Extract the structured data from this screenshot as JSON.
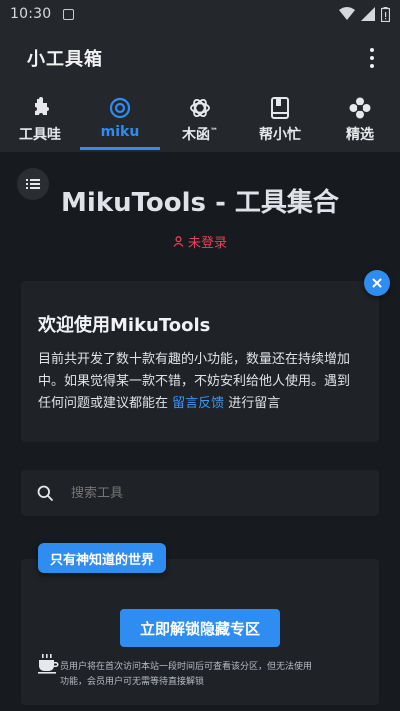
{
  "status_bar": {
    "time": "10:30",
    "icons": [
      "notification-icon",
      "wifi-icon",
      "signal-icon",
      "battery-icon"
    ]
  },
  "app_bar": {
    "title": "小工具箱",
    "menu_icon": "more-vert-icon"
  },
  "tabs": [
    {
      "label": "工具哇",
      "icon": "puzzle-icon",
      "active": false
    },
    {
      "label": "miku",
      "icon": "target-icon",
      "active": true
    },
    {
      "label": "木函",
      "icon": "openai-icon",
      "active": false,
      "sup": "™"
    },
    {
      "label": "帮小忙",
      "icon": "book-icon",
      "active": false
    },
    {
      "label": "精选",
      "icon": "flower-icon",
      "active": false
    }
  ],
  "main": {
    "title": "MikuTools - 工具集合",
    "login_status": "未登录",
    "welcome": {
      "title": "欢迎使用MikuTools",
      "body_before": "目前共开发了数十款有趣的小功能，数量还在持续增加中。如果觉得某一款不错，不妨安利给他人使用。遇到任何问题或建议都能在 ",
      "link": "留言反馈",
      "body_after": " 进行留言"
    },
    "search": {
      "placeholder": "搜索工具"
    },
    "secret": {
      "badge": "只有神知道的世界",
      "button": "立即解锁隐藏专区",
      "note": "员用户将在首次访问本站一段时间后可查看该分区，但无法使用\n功能，会员用户可无需等待直接解锁"
    }
  },
  "colors": {
    "accent": "#2f8cf0",
    "background": "#171a1e",
    "surface": "#1f2226",
    "bar": "#24272b",
    "error": "#e0455a"
  }
}
